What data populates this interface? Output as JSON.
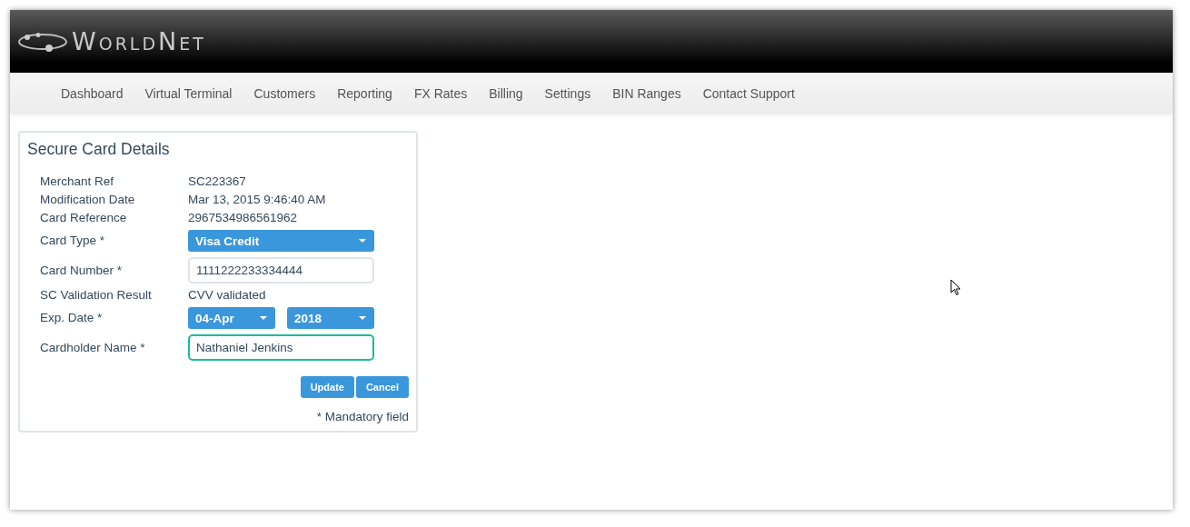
{
  "header": {
    "logo": "WorldNet"
  },
  "nav": [
    "Dashboard",
    "Virtual Terminal",
    "Customers",
    "Reporting",
    "FX Rates",
    "Billing",
    "Settings",
    "BIN Ranges",
    "Contact Support"
  ],
  "panel": {
    "title": "Secure Card Details",
    "rows": [
      {
        "kind": "text",
        "label": "Merchant Ref",
        "value": "SC223367"
      },
      {
        "kind": "text",
        "label": "Modification Date",
        "value": "Mar 13, 2015 9:46:40 AM"
      },
      {
        "kind": "text",
        "label": "Card Reference",
        "value": "2967534986561962"
      },
      {
        "kind": "select",
        "label": "Card Type *",
        "values": [
          "Visa Credit"
        ]
      },
      {
        "kind": "input",
        "label": "Card Number *",
        "value": "1111222233334444",
        "focused": false
      },
      {
        "kind": "text",
        "label": "SC Validation Result",
        "value": "CVV validated"
      },
      {
        "kind": "select",
        "label": "Exp. Date *",
        "values": [
          "04-Apr",
          "2018"
        ]
      },
      {
        "kind": "input",
        "label": "Cardholder Name *",
        "value": "Nathaniel Jenkins",
        "focused": true
      }
    ],
    "buttons": [
      "Update",
      "Cancel"
    ],
    "note": "* Mandatory field"
  }
}
